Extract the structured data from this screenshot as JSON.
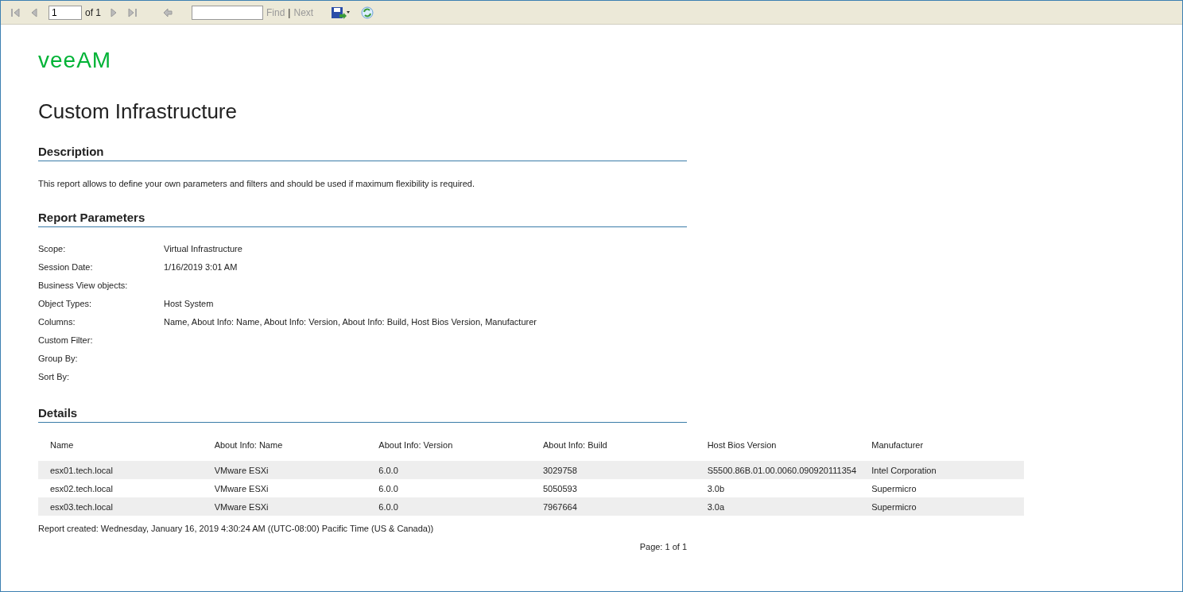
{
  "toolbar": {
    "page_input": "1",
    "page_count": "of 1",
    "find_label": "Find",
    "separator": "|",
    "next_label": "Next"
  },
  "report": {
    "logo": "veeAM",
    "title": "Custom Infrastructure",
    "description": {
      "heading": "Description",
      "text": "This report allows to define your own parameters and filters and should be used if maximum flexibility is required."
    },
    "parameters": {
      "heading": "Report Parameters",
      "rows": [
        {
          "label": "Scope:",
          "value": "Virtual Infrastructure"
        },
        {
          "label": "Session Date:",
          "value": "1/16/2019 3:01 AM"
        },
        {
          "label": "Business View objects:"
        },
        {
          "label": "Object Types:",
          "value": "Host System"
        },
        {
          "label": "Columns:",
          "value": "Name, About Info: Name, About Info: Version, About Info: Build, Host Bios Version, Manufacturer"
        },
        {
          "label": "Custom Filter:"
        },
        {
          "label": "Group By:"
        },
        {
          "label": "Sort By:"
        }
      ]
    },
    "details": {
      "heading": "Details",
      "table": {
        "columns": [
          "Name",
          "About Info: Name",
          "About Info: Version",
          "About Info: Build",
          "Host Bios Version",
          "Manufacturer"
        ],
        "rows": [
          [
            "esx01.tech.local",
            "VMware ESXi",
            "6.0.0",
            "3029758",
            "S5500.86B.01.00.0060.090920111354",
            "Intel Corporation"
          ],
          [
            "esx02.tech.local",
            "VMware ESXi",
            "6.0.0",
            "5050593",
            "3.0b",
            "Supermicro"
          ],
          [
            "esx03.tech.local",
            "VMware ESXi",
            "6.0.0",
            "7967664",
            "3.0a",
            "Supermicro"
          ]
        ]
      }
    },
    "created": "Report created:  Wednesday, January 16, 2019 4:30:24 AM ((UTC-08:00) Pacific Time (US & Canada))",
    "page_footer": "Page: 1 of 1"
  }
}
